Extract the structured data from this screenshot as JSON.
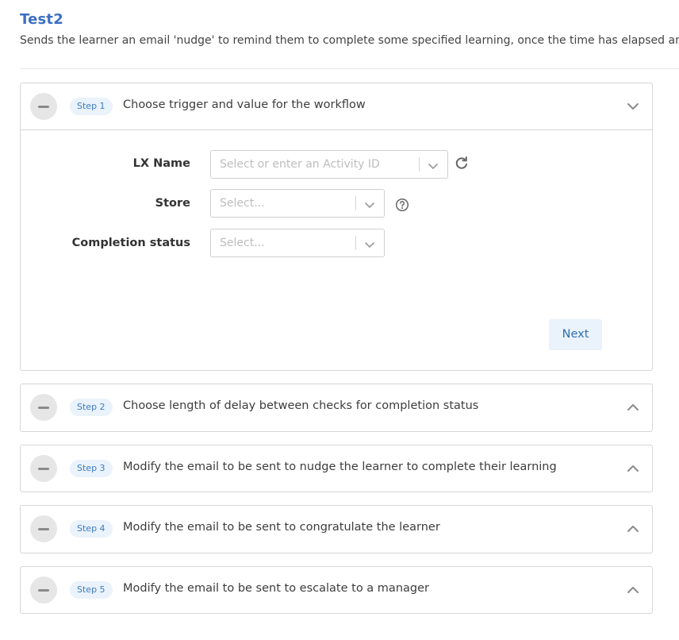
{
  "header": {
    "title": "Test2",
    "description": "Sends the learner an email 'nudge' to remind them to complete some specified learning, once the time has elapsed an"
  },
  "steps": [
    {
      "pill": "Step 1",
      "text": "Choose trigger and value for the workflow",
      "chevron": "chevron-down-icon",
      "expanded": true
    },
    {
      "pill": "Step 2",
      "text": "Choose length of delay between checks for completion status",
      "chevron": "chevron-up-icon",
      "expanded": false
    },
    {
      "pill": "Step 3",
      "text": "Modify the email to be sent to nudge the learner to complete their learning",
      "chevron": "chevron-up-icon",
      "expanded": false
    },
    {
      "pill": "Step 4",
      "text": "Modify the email to be sent to congratulate the learner",
      "chevron": "chevron-up-icon",
      "expanded": false
    },
    {
      "pill": "Step 5",
      "text": "Modify the email to be sent to escalate to a manager",
      "chevron": "chevron-up-icon",
      "expanded": false
    }
  ],
  "form": {
    "lx_name": {
      "label": "LX Name",
      "placeholder": "Select or enter an Activity ID"
    },
    "store": {
      "label": "Store",
      "placeholder": "Select..."
    },
    "completion_status": {
      "label": "Completion status",
      "placeholder": "Select..."
    },
    "next_label": "Next"
  },
  "colors": {
    "title": "#3c6fc4",
    "pill_bg": "#eaf2fb",
    "pill_text": "#3b7cc4",
    "button_bg": "#eaf2fb",
    "button_text": "#2f6fb5",
    "border": "#d6d6d6"
  }
}
